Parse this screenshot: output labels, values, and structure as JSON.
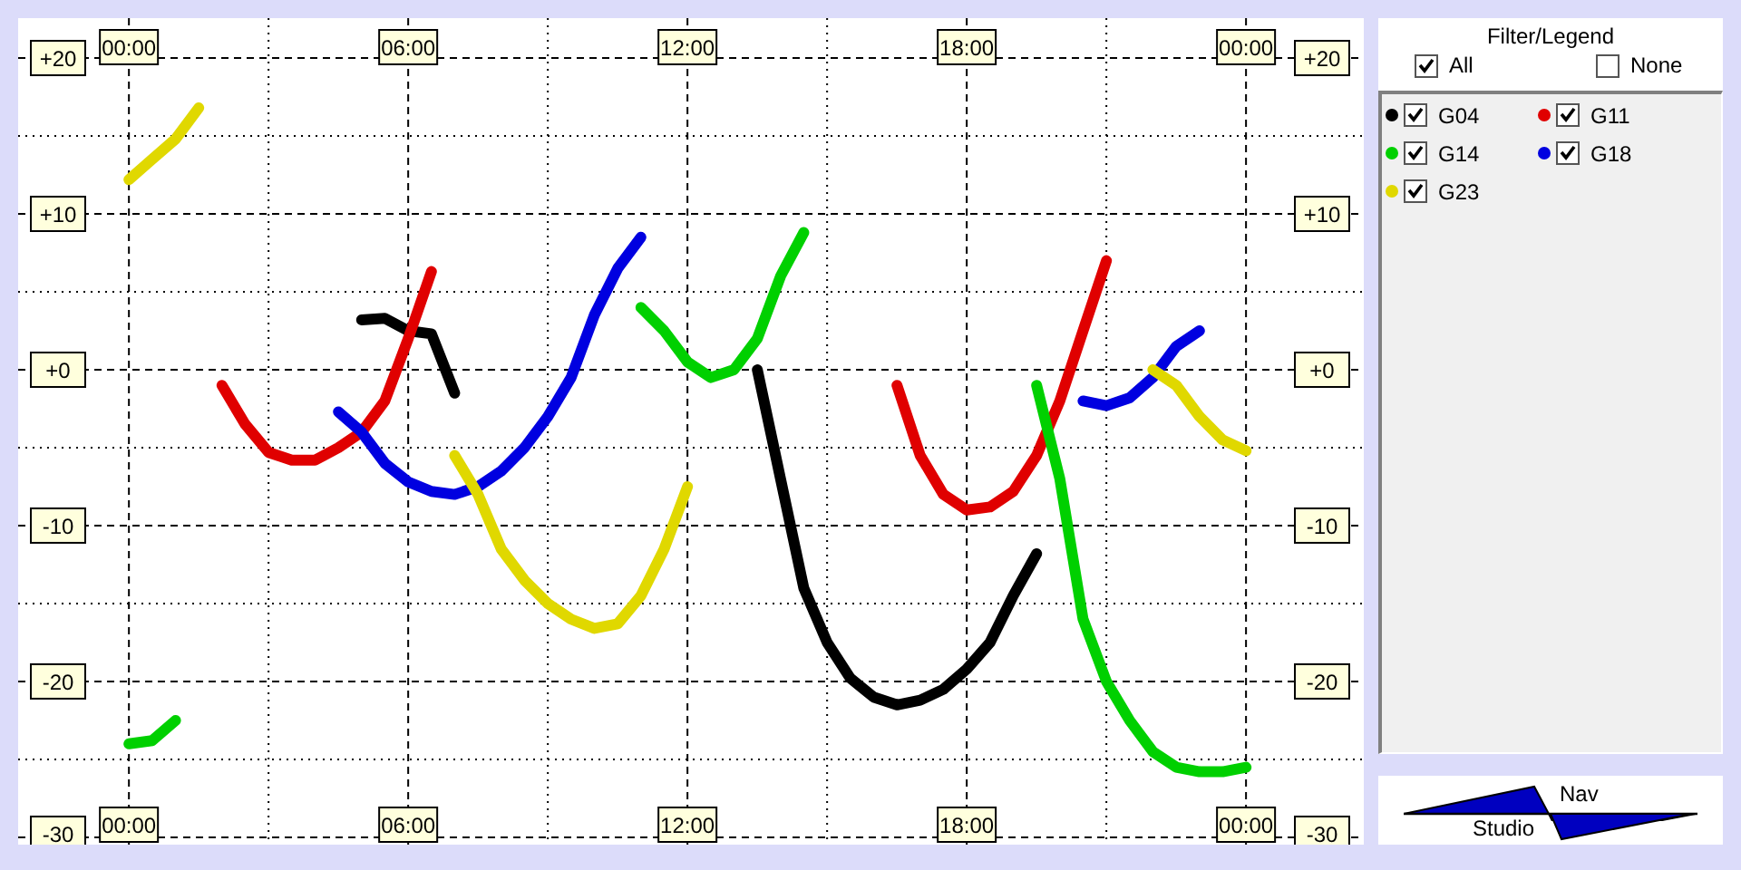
{
  "chart": {
    "chart_data": {
      "type": "line",
      "x": [
        0,
        0.5,
        1,
        1.5,
        2,
        2.5,
        3,
        3.5,
        4,
        4.5,
        5,
        5.5,
        6,
        6.5,
        7,
        7.5,
        8,
        8.5,
        9,
        9.5,
        10,
        10.5,
        11,
        11.5,
        12,
        12.5,
        13,
        13.5,
        14,
        14.5,
        15,
        15.5,
        16,
        16.5,
        17,
        17.5,
        18,
        18.5,
        19,
        19.5,
        20,
        20.5,
        21,
        21.5,
        22,
        22.5,
        23,
        23.5,
        24
      ],
      "xlim": [
        -2.38,
        26.53
      ],
      "ylim": [
        -30.47,
        22.56
      ],
      "grid": true,
      "xticks": [
        {
          "value": 0,
          "label": "00:00"
        },
        {
          "value": 6,
          "label": "06:00"
        },
        {
          "value": 12,
          "label": "12:00"
        },
        {
          "value": 18,
          "label": "18:00"
        },
        {
          "value": 24,
          "label": "00:00"
        }
      ],
      "yticks": [
        {
          "value": 20,
          "label": "+20"
        },
        {
          "value": 10,
          "label": "+10"
        },
        {
          "value": 0,
          "label": "+0"
        },
        {
          "value": -10,
          "label": "-10"
        },
        {
          "value": -20,
          "label": "-20"
        },
        {
          "value": -30,
          "label": "-30"
        }
      ],
      "series": [
        {
          "name": "G04",
          "color": "#000000",
          "values": [
            null,
            null,
            null,
            null,
            null,
            null,
            null,
            null,
            null,
            null,
            3.2,
            3.3,
            2.5,
            2.3,
            -1.5,
            null,
            null,
            null,
            null,
            null,
            null,
            null,
            null,
            null,
            null,
            null,
            null,
            0,
            -7,
            -14,
            -17.5,
            -19.8,
            -21,
            -21.5,
            -21.2,
            -20.5,
            -19.2,
            -17.5,
            -14.5,
            -11.8,
            null,
            null,
            null,
            null,
            null,
            null,
            null,
            null,
            null
          ]
        },
        {
          "name": "G11",
          "color": "#e00000",
          "values": [
            null,
            null,
            null,
            null,
            -1,
            -3.5,
            -5.3,
            -5.8,
            -5.8,
            -5,
            -4,
            -2,
            2,
            6.3,
            null,
            null,
            null,
            null,
            null,
            null,
            null,
            null,
            null,
            null,
            null,
            null,
            null,
            null,
            null,
            null,
            null,
            null,
            null,
            -1,
            -5.5,
            -8,
            -9,
            -8.8,
            -7.8,
            -5.5,
            -2,
            2.5,
            7,
            null,
            null,
            null,
            null,
            null,
            null
          ]
        },
        {
          "name": "G14",
          "color": "#00d000",
          "values": [
            -24,
            -23.8,
            -22.5,
            null,
            null,
            null,
            null,
            null,
            null,
            null,
            null,
            null,
            null,
            null,
            null,
            null,
            null,
            null,
            null,
            null,
            null,
            null,
            4,
            2.5,
            0.5,
            -0.5,
            0,
            2,
            6,
            8.8,
            null,
            null,
            null,
            null,
            null,
            null,
            null,
            null,
            null,
            -1,
            -7,
            -16,
            -20,
            -22.5,
            -24.5,
            -25.5,
            -25.8,
            -25.8,
            -25.5
          ]
        },
        {
          "name": "G18",
          "color": "#0000e0",
          "values": [
            null,
            null,
            null,
            null,
            null,
            null,
            null,
            null,
            null,
            -2.7,
            -4,
            -6,
            -7.2,
            -7.8,
            -8,
            -7.5,
            -6.5,
            -5,
            -3,
            -0.5,
            3.5,
            6.5,
            8.5,
            null,
            null,
            null,
            null,
            null,
            null,
            null,
            null,
            null,
            null,
            null,
            null,
            null,
            null,
            null,
            null,
            null,
            null,
            -2,
            -2.3,
            -1.8,
            -0.5,
            1.5,
            2.5,
            null,
            null
          ]
        },
        {
          "name": "G23",
          "color": "#e0d800",
          "values": [
            12.2,
            13.5,
            14.8,
            16.8,
            null,
            null,
            null,
            null,
            null,
            null,
            null,
            null,
            null,
            null,
            -5.5,
            -8,
            -11.5,
            -13.5,
            -15,
            -16,
            -16.6,
            -16.3,
            -14.5,
            -11.5,
            -7.5,
            null,
            null,
            null,
            null,
            null,
            null,
            null,
            null,
            null,
            null,
            null,
            null,
            null,
            null,
            null,
            null,
            null,
            null,
            null,
            0,
            -1,
            -3,
            -4.5,
            -5.2
          ]
        }
      ]
    }
  },
  "legend": {
    "title": "Filter/Legend",
    "select_all": {
      "label": "All",
      "checked": true
    },
    "select_none": {
      "label": "None",
      "checked": false
    },
    "items": [
      {
        "checked": true
      },
      {
        "checked": true
      },
      {
        "checked": true
      },
      {
        "checked": true
      },
      {
        "checked": true
      }
    ]
  },
  "logo": {
    "top_word": "Nav",
    "bottom_word": "Studio"
  }
}
